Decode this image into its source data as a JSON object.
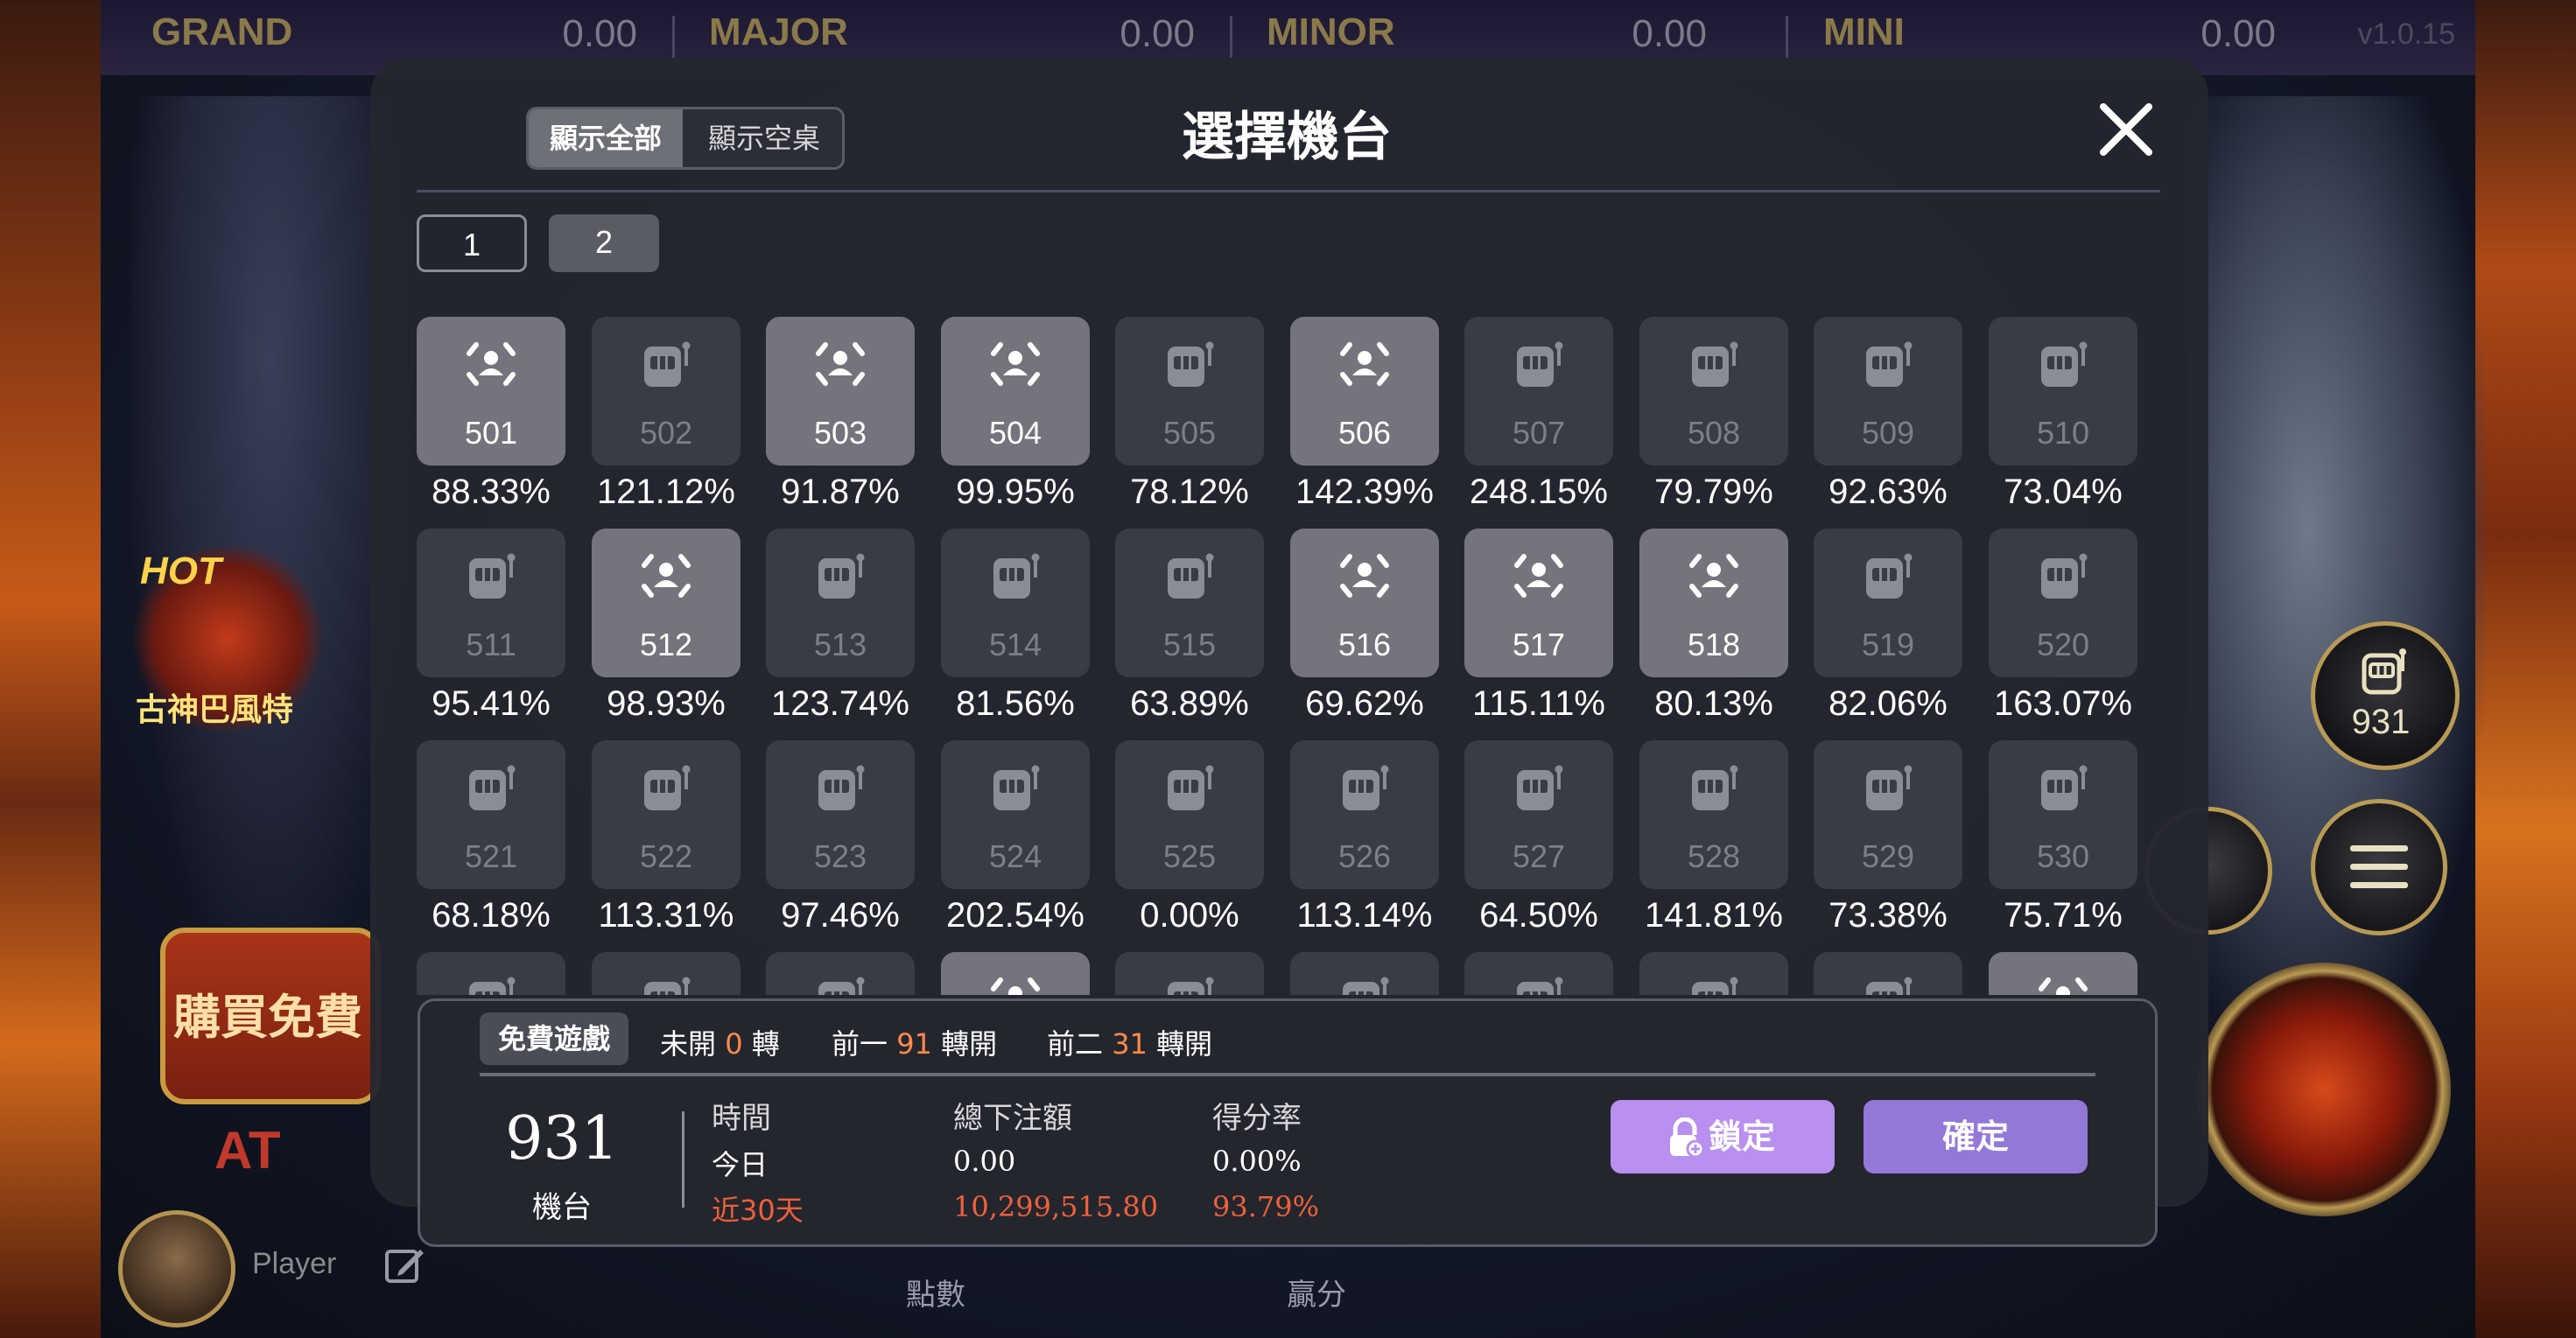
{
  "jackpots": [
    {
      "name": "GRAND",
      "value": "0.00"
    },
    {
      "name": "MAJOR",
      "value": "0.00"
    },
    {
      "name": "MINOR",
      "value": "0.00"
    },
    {
      "name": "MINI",
      "value": "0.00"
    }
  ],
  "version": "v1.0.15",
  "background": {
    "hot_badge_text": "HOT",
    "hot_game_name": "古神巴風特",
    "buy_free_label": "購買免費",
    "logo_text": "AT",
    "player_name": "Player",
    "points_label": "點數",
    "win_label": "贏分",
    "machine_count": "931"
  },
  "modal": {
    "filter_all": "顯示全部",
    "filter_empty": "顯示空桌",
    "title": "選擇機台",
    "pages": [
      "1",
      "2"
    ],
    "active_page": "2",
    "machines": [
      {
        "id": "501",
        "rate": "88.33%",
        "occupied": true
      },
      {
        "id": "502",
        "rate": "121.12%",
        "occupied": false
      },
      {
        "id": "503",
        "rate": "91.87%",
        "occupied": true
      },
      {
        "id": "504",
        "rate": "99.95%",
        "occupied": true
      },
      {
        "id": "505",
        "rate": "78.12%",
        "occupied": false
      },
      {
        "id": "506",
        "rate": "142.39%",
        "occupied": true
      },
      {
        "id": "507",
        "rate": "248.15%",
        "occupied": false
      },
      {
        "id": "508",
        "rate": "79.79%",
        "occupied": false
      },
      {
        "id": "509",
        "rate": "92.63%",
        "occupied": false
      },
      {
        "id": "510",
        "rate": "73.04%",
        "occupied": false
      },
      {
        "id": "511",
        "rate": "95.41%",
        "occupied": false
      },
      {
        "id": "512",
        "rate": "98.93%",
        "occupied": true
      },
      {
        "id": "513",
        "rate": "123.74%",
        "occupied": false
      },
      {
        "id": "514",
        "rate": "81.56%",
        "occupied": false
      },
      {
        "id": "515",
        "rate": "63.89%",
        "occupied": false
      },
      {
        "id": "516",
        "rate": "69.62%",
        "occupied": true
      },
      {
        "id": "517",
        "rate": "115.11%",
        "occupied": true
      },
      {
        "id": "518",
        "rate": "80.13%",
        "occupied": true
      },
      {
        "id": "519",
        "rate": "82.06%",
        "occupied": false
      },
      {
        "id": "520",
        "rate": "163.07%",
        "occupied": false
      },
      {
        "id": "521",
        "rate": "68.18%",
        "occupied": false
      },
      {
        "id": "522",
        "rate": "113.31%",
        "occupied": false
      },
      {
        "id": "523",
        "rate": "97.46%",
        "occupied": false
      },
      {
        "id": "524",
        "rate": "202.54%",
        "occupied": false
      },
      {
        "id": "525",
        "rate": "0.00%",
        "occupied": false
      },
      {
        "id": "526",
        "rate": "113.14%",
        "occupied": false
      },
      {
        "id": "527",
        "rate": "64.50%",
        "occupied": false
      },
      {
        "id": "528",
        "rate": "141.81%",
        "occupied": false
      },
      {
        "id": "529",
        "rate": "73.38%",
        "occupied": false
      },
      {
        "id": "530",
        "rate": "75.71%",
        "occupied": false
      }
    ],
    "partial_row_occupied": [
      false,
      false,
      false,
      true,
      false,
      false,
      false,
      false,
      false,
      true
    ]
  },
  "info": {
    "tab_free_game": "免費遊戲",
    "stats": [
      {
        "prefix": "未開",
        "value": "0",
        "suffix": "轉"
      },
      {
        "prefix": "前一",
        "value": "91",
        "suffix": "轉開"
      },
      {
        "prefix": "前二",
        "value": "31",
        "suffix": "轉開"
      }
    ],
    "machine_number": "931",
    "machine_label": "機台",
    "columns": {
      "time": "時間",
      "total_bet": "總下注額",
      "score_rate": "得分率"
    },
    "rows": [
      {
        "time": "今日",
        "total_bet": "0.00",
        "score_rate": "0.00%"
      },
      {
        "time": "近30天",
        "total_bet": "10,299,515.80",
        "score_rate": "93.79%"
      }
    ],
    "lock_label": "鎖定",
    "confirm_label": "確定"
  },
  "colors": {
    "accent_lock": "#b98ff0",
    "accent_confirm": "#9478d8",
    "highlight_number": "#ff8a4a",
    "highlight_30d": "#f0603a"
  }
}
